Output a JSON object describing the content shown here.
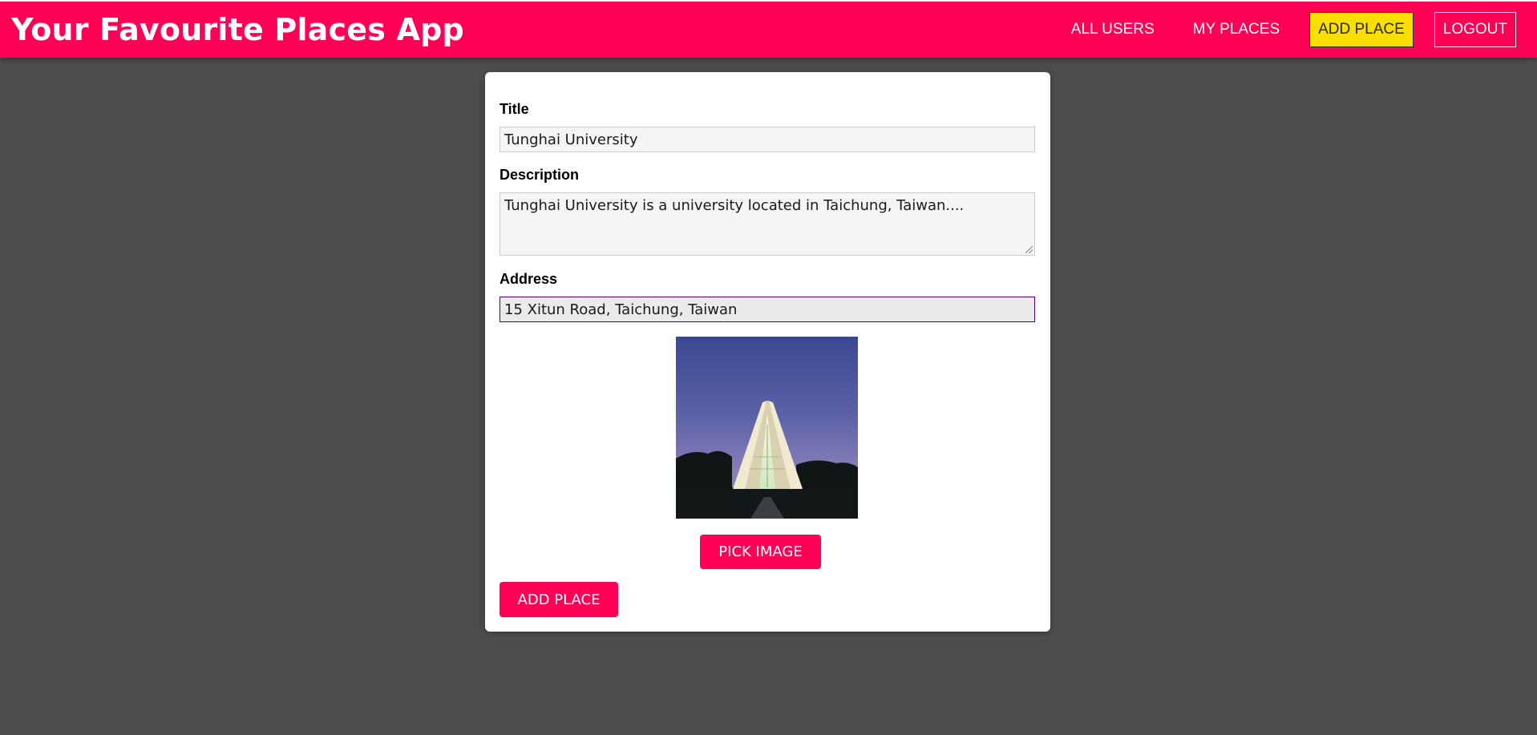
{
  "header": {
    "title": "Your Favourite Places App",
    "nav": [
      {
        "label": "ALL USERS"
      },
      {
        "label": "MY PLACES"
      },
      {
        "label": "ADD PLACE"
      },
      {
        "label": "LOGOUT"
      }
    ]
  },
  "form": {
    "title_label": "Title",
    "title_value": "Tunghai University",
    "description_label": "Description",
    "description_value": "Tunghai University is a university located in Taichung, Taiwan....",
    "address_label": "Address",
    "address_value": "15 Xitun Road, Taichung, Taiwan",
    "pick_image_label": "PICK IMAGE",
    "submit_label": "ADD PLACE"
  },
  "colors": {
    "brand": "#ff0055",
    "active_nav": "#f8df00",
    "background": "#4c4c4c",
    "focus_border": "#510077"
  },
  "icons": {
    "preview": "church-photo"
  }
}
